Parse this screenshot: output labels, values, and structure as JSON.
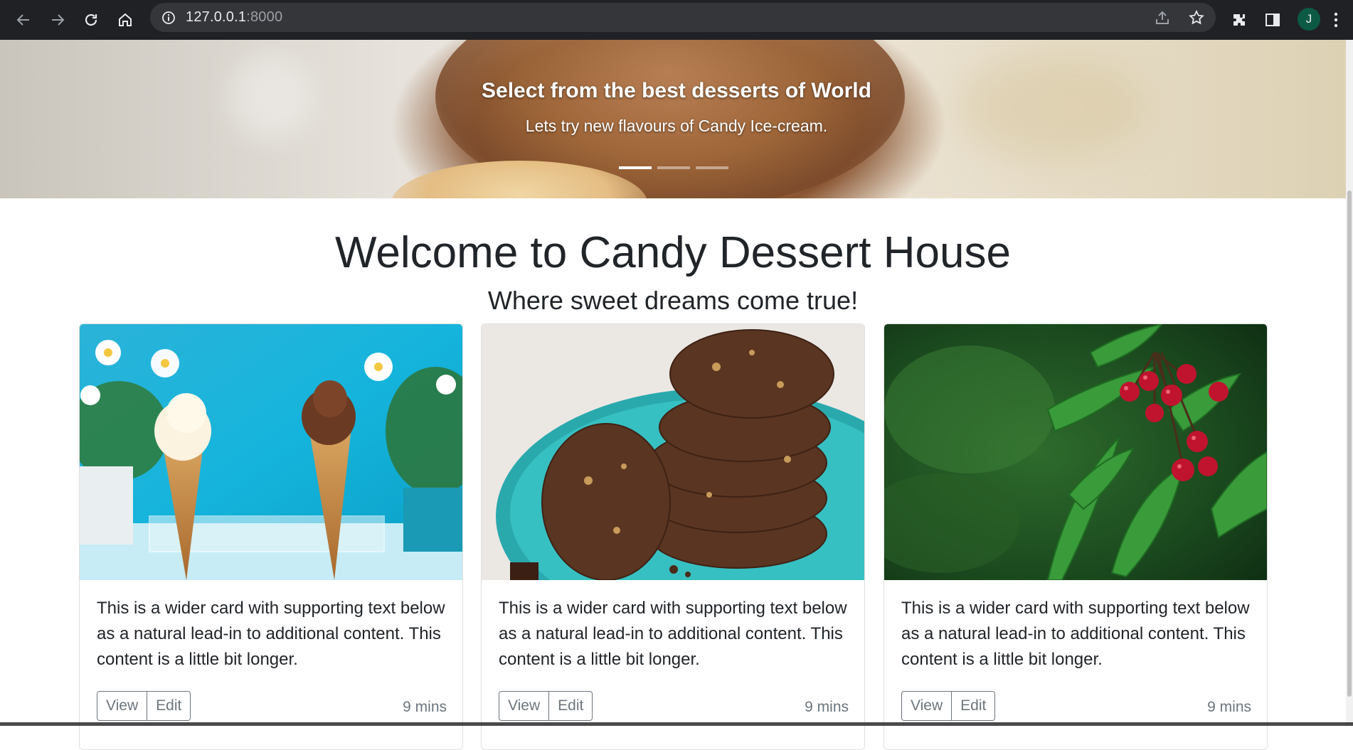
{
  "browser": {
    "url_host": "127.0.0.1",
    "url_port": ":8000",
    "profile_initial": "J",
    "icons": [
      "back-icon",
      "forward-icon",
      "reload-icon",
      "home-icon",
      "info-icon",
      "share-icon",
      "bookmark-star-icon",
      "extensions-icon",
      "side-panel-icon"
    ]
  },
  "hero": {
    "title": "Select from the best desserts of World",
    "subtitle": "Lets try new flavours of Candy Ice-cream.",
    "slides": 3,
    "active_slide": 1
  },
  "page": {
    "heading": "Welcome to Candy Dessert House",
    "tagline": "Where sweet dreams come true!"
  },
  "cards": [
    {
      "image": "ice-cream-cones-photo",
      "text": "This is a wider card with supporting text below as a natural lead-in to additional content. This content is a little bit longer.",
      "view_label": "View",
      "edit_label": "Edit",
      "time": "9 mins"
    },
    {
      "image": "chocolate-cookies-photo",
      "text": "This is a wider card with supporting text below as a natural lead-in to additional content. This content is a little bit longer.",
      "view_label": "View",
      "edit_label": "Edit",
      "time": "9 mins"
    },
    {
      "image": "cherries-photo",
      "text": "This is a wider card with supporting text below as a natural lead-in to additional content. This content is a little bit longer.",
      "view_label": "View",
      "edit_label": "Edit",
      "time": "9 mins"
    }
  ]
}
